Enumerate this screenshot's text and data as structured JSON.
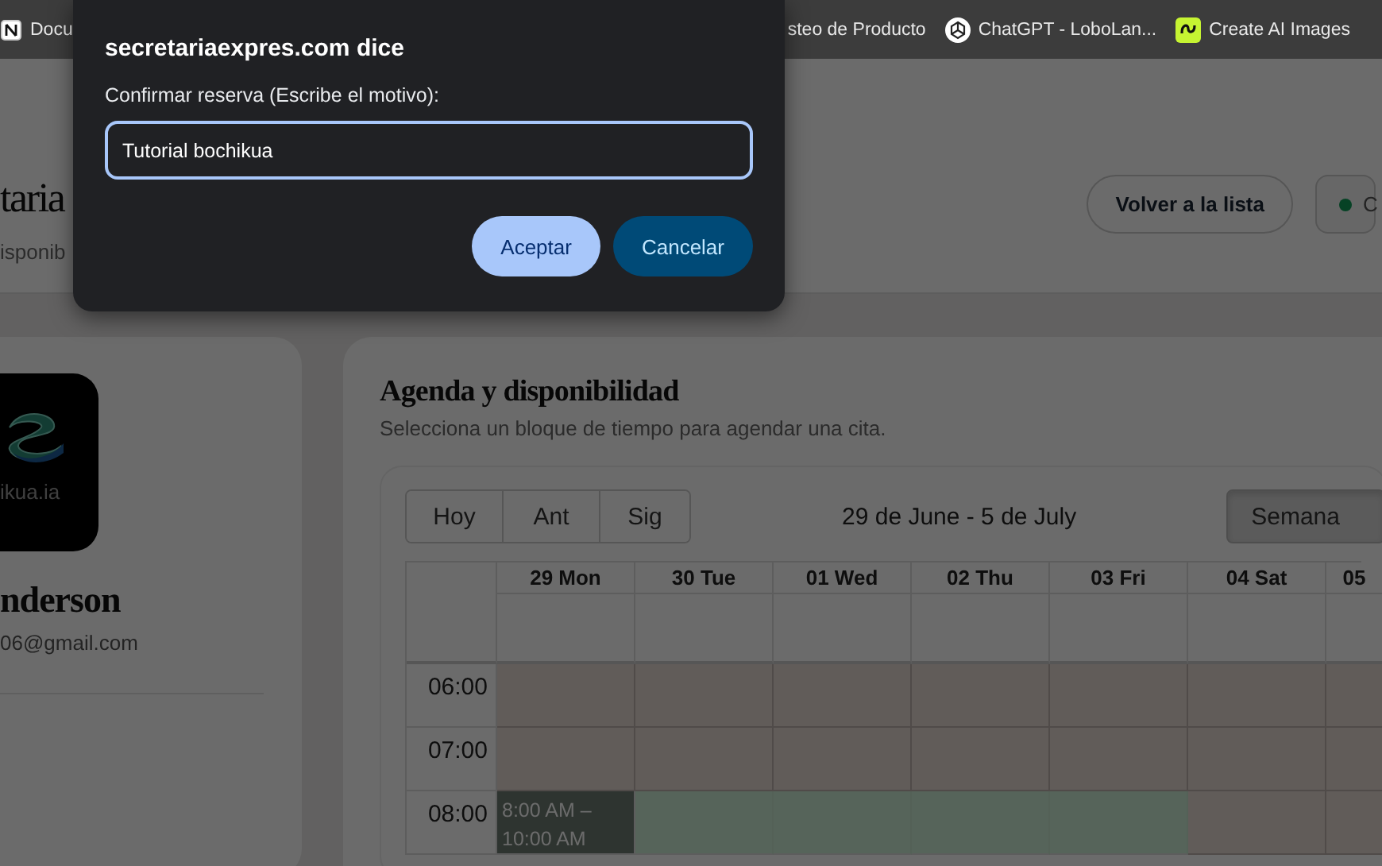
{
  "bookmarks": [
    {
      "label": "Docu",
      "kind": "square"
    },
    {
      "label": "steo de Producto",
      "kind": "plain"
    },
    {
      "label": "ChatGPT - LoboLan...",
      "kind": "knot"
    },
    {
      "label": "Create AI Images",
      "kind": "squiggle"
    }
  ],
  "dialog": {
    "title": "secretariaexpres.com dice",
    "message": "Confirmar reserva (Escribe el motivo):",
    "input": {
      "value": "Tutorial bochikua"
    },
    "buttons": [
      {
        "label": "Aceptar",
        "kind": "primary"
      },
      {
        "label": "Cancelar",
        "kind": "secondary"
      }
    ]
  },
  "header": {
    "title": "taria",
    "subtitle": "isponib",
    "actions": [
      {
        "label": "Volver a la lista",
        "kind": "outline"
      },
      {
        "label": "C",
        "kind": "status"
      }
    ]
  },
  "profile": {
    "logo_text": "ikua.ia",
    "name": "nderson",
    "email": "06@gmail.com"
  },
  "agenda": {
    "title": "Agenda y disponibilidad",
    "subtitle": "Selecciona un bloque de tiempo para agendar una cita.",
    "nav": [
      "Hoy",
      "Ant",
      "Sig"
    ],
    "range": "29 de June - 5 de July",
    "views": [
      {
        "label": "Semana",
        "selected": true
      }
    ],
    "days": [
      "29 Mon",
      "30 Tue",
      "01 Wed",
      "02 Thu",
      "03 Fri",
      "04 Sat",
      "05"
    ],
    "hours": [
      {
        "time": "06:00",
        "slots": [
          {
            "kind": "unavailable"
          },
          {
            "kind": "unavailable"
          },
          {
            "kind": "unavailable"
          },
          {
            "kind": "unavailable"
          },
          {
            "kind": "unavailable"
          },
          {
            "kind": "unavailable"
          },
          {
            "kind": "unavailable"
          }
        ]
      },
      {
        "time": "07:00",
        "slots": [
          {
            "kind": "unavailable"
          },
          {
            "kind": "unavailable"
          },
          {
            "kind": "unavailable"
          },
          {
            "kind": "unavailable"
          },
          {
            "kind": "unavailable"
          },
          {
            "kind": "unavailable"
          },
          {
            "kind": "unavailable"
          }
        ]
      },
      {
        "time": "08:00",
        "slots": [
          {
            "kind": "booked",
            "text": "8:00 AM – 10:00 AM"
          },
          {
            "kind": "available"
          },
          {
            "kind": "available"
          },
          {
            "kind": "available"
          },
          {
            "kind": "available"
          },
          {
            "kind": "unavailable"
          },
          {
            "kind": "unavailable"
          }
        ]
      }
    ]
  }
}
